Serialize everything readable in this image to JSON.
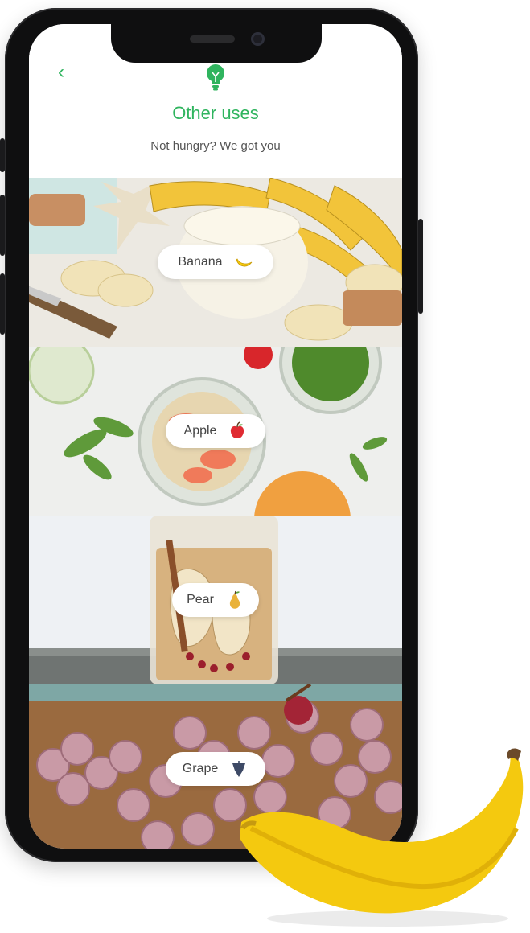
{
  "header": {
    "title": "Other uses",
    "subtitle": "Not hungry? We got you"
  },
  "icons": {
    "back": "chevron-left-icon",
    "tip": "lightbulb-icon"
  },
  "items": [
    {
      "label": "Banana",
      "icon": "banana-icon"
    },
    {
      "label": "Apple",
      "icon": "apple-icon"
    },
    {
      "label": "Pear",
      "icon": "pear-icon"
    },
    {
      "label": "Grape",
      "icon": "grape-icon"
    }
  ],
  "colors": {
    "accent": "#2fb45e",
    "banana": "#f4c90f",
    "apple": "#e02b32",
    "pear": "#e9b23a",
    "grape": "#3e4a66"
  }
}
